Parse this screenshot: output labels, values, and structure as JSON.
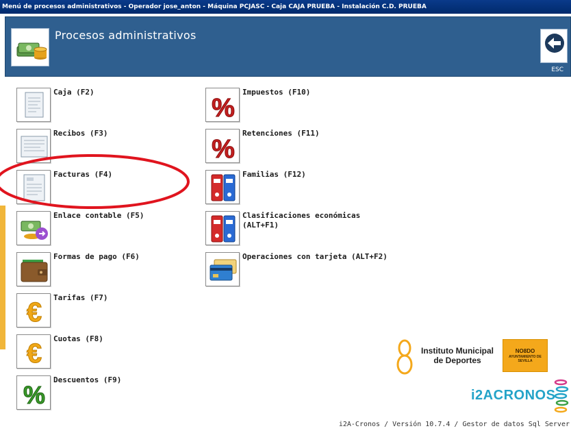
{
  "window": {
    "title": "Menú de procesos administrativos - Operador jose_anton - Máquina PCJASC - Caja CAJA PRUEBA - Instalación C.D. PRUEBA"
  },
  "header": {
    "title": "Procesos administrativos",
    "esc_label": "ESC"
  },
  "menu_left": [
    {
      "label": "Caja (F2)",
      "icon": "document-icon"
    },
    {
      "label": "Recibos (F3)",
      "icon": "receipt-icon"
    },
    {
      "label": "Facturas (F4)",
      "icon": "invoice-icon"
    },
    {
      "label": "Enlace contable (F5)",
      "icon": "money-link-icon"
    },
    {
      "label": "Formas de pago (F6)",
      "icon": "wallet-icon"
    },
    {
      "label": "Tarifas (F7)",
      "icon": "euro-icon"
    },
    {
      "label": "Cuotas (F8)",
      "icon": "euro-icon"
    },
    {
      "label": "Descuentos (F9)",
      "icon": "percent-green-icon"
    }
  ],
  "menu_right": [
    {
      "label": "Impuestos (F10)",
      "icon": "percent-red-icon"
    },
    {
      "label": "Retenciones (F11)",
      "icon": "percent-red-icon"
    },
    {
      "label": "Familias (F12)",
      "icon": "binders-icon"
    },
    {
      "label": "Clasificaciones económicas\n(ALT+F1)",
      "icon": "binders-icon"
    },
    {
      "label": "Operaciones con tarjeta (ALT+F2)",
      "icon": "credit-card-icon"
    }
  ],
  "logos": {
    "imd_text": "Instituto Municipal de Deportes",
    "nodo": "NO8DO",
    "ayuntamiento": "AYUNTAMIENTO DE SEVILLA",
    "cronos": "i2ACRONOS"
  },
  "footer": {
    "version_text": "i2A-Cronos / Versión 10.7.4 / Gestor de datos Sql Server"
  },
  "colors": {
    "header_bg": "#2f5f8f",
    "titlebar_bg": "#0a3a8a",
    "annotation_red": "#e0141e",
    "cronos_blue": "#23a3c8"
  }
}
